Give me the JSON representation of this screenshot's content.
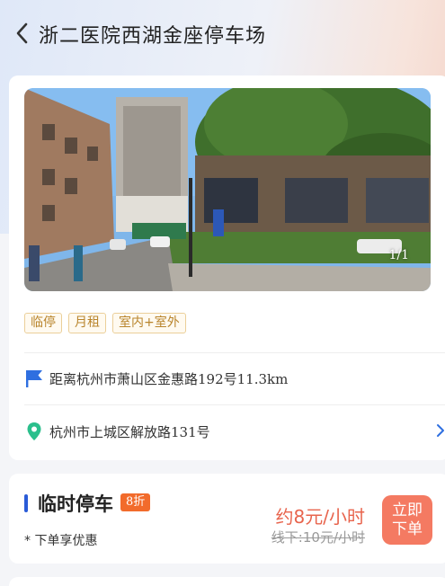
{
  "header": {
    "title": "浙二医院西湖金座停车场",
    "back_icon": "chevron-left-icon"
  },
  "gallery": {
    "counter": "1/1"
  },
  "tags": [
    "临停",
    "月租",
    "室内+室外"
  ],
  "distance": {
    "icon": "flag-icon",
    "icon_color": "#2f6fe0",
    "text": "距离杭州市萧山区金惠路192号11.3km"
  },
  "address": {
    "icon": "location-pin-icon",
    "icon_color": "#2bbf8c",
    "text": "杭州市上城区解放路131号",
    "chevron_icon": "chevron-right-icon"
  },
  "temporary_parking": {
    "title": "临时停车",
    "discount": "8折",
    "promo": "* 下单享优惠",
    "price": "约8元/小时",
    "original_price": "线下:10元/小时",
    "order_button": "立即下单",
    "accent_color": "#2a5bd7",
    "price_color": "#e8644d",
    "button_color": "#f47a62"
  }
}
